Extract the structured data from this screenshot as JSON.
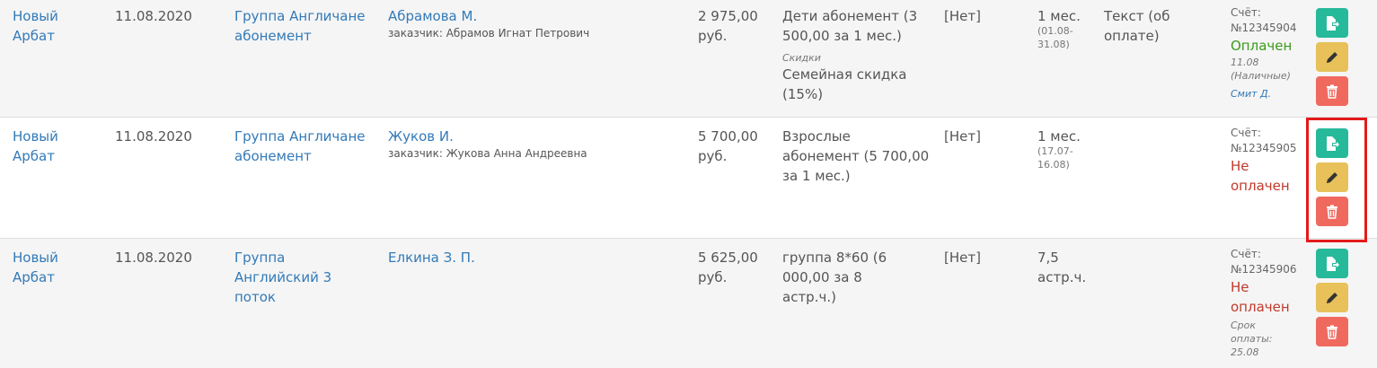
{
  "rows": [
    {
      "branch": "Новый Арбат",
      "date": "11.08.2020",
      "group": "Группа Англичане абонемент",
      "student": "Абрамова М.",
      "customer": "заказчик: Абрамов Игнат Петрович",
      "amount": "2 975,00 руб.",
      "tariff": "Дети абонемент (3 500,00 за 1 мес.)",
      "discount_label": "Скидки",
      "discount": "Семейная скидка (15%)",
      "none": "[Нет]",
      "period": "1 мес.",
      "period_range": "(01.08-31.08)",
      "note": "Текст (об оплате)",
      "invoice_label": "Счёт:",
      "invoice_no": "№12345904",
      "status": "Оплачен",
      "status_kind": "paid",
      "status_detail": "11.08 (Наличные)",
      "status_who": "Смит Д."
    },
    {
      "branch": "Новый Арбат",
      "date": "11.08.2020",
      "group": "Группа Англичане абонемент",
      "student": "Жуков И.",
      "customer": "заказчик: Жукова Анна Андреевна",
      "amount": "5 700,00 руб.",
      "tariff": "Взрослые абонемент (5 700,00 за 1 мес.)",
      "none": "[Нет]",
      "period": "1 мес.",
      "period_range": "(17.07-16.08)",
      "invoice_label": "Счёт:",
      "invoice_no": "№12345905",
      "status": "Не оплачен",
      "status_kind": "unpaid"
    },
    {
      "branch": "Новый Арбат",
      "date": "11.08.2020",
      "group": "Группа Английский 3 поток",
      "student": "Елкина З. П.",
      "amount": "5 625,00 руб.",
      "tariff": "группа 8*60 (6 000,00 за 8 астр.ч.)",
      "none": "[Нет]",
      "period": "7,5 астр.ч.",
      "invoice_label": "Счёт:",
      "invoice_no": "№12345906",
      "status": "Не оплачен",
      "status_kind": "unpaid",
      "status_detail": "Срок оплаты: 25.08"
    }
  ],
  "icons": {
    "pay": "file-export-icon",
    "edit": "pencil-icon",
    "delete": "trash-icon"
  },
  "colors": {
    "link": "#337ab7",
    "paid": "#3c9a1e",
    "unpaid": "#c0392b",
    "btn_pay": "#26b99a",
    "btn_edit": "#e8c15b",
    "btn_delete": "#f0695f",
    "highlight": "#e41a1a"
  }
}
